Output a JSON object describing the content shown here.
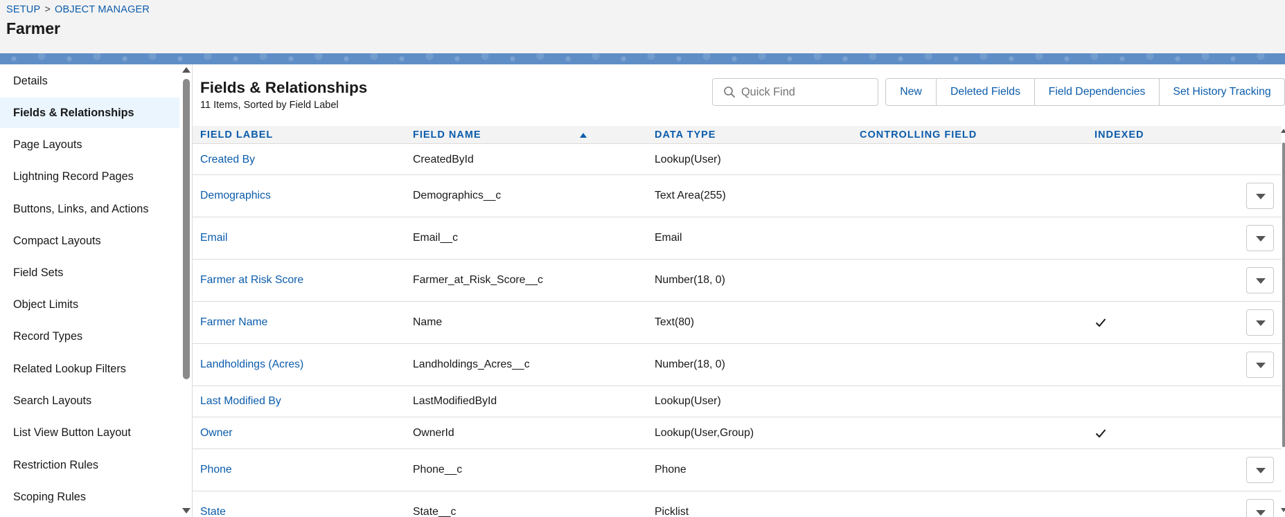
{
  "header": {
    "breadcrumb": [
      "SETUP",
      "OBJECT MANAGER"
    ],
    "breadcrumb_separator": ">",
    "title": "Farmer"
  },
  "sidebar": {
    "items": [
      {
        "label": "Details",
        "active": false
      },
      {
        "label": "Fields & Relationships",
        "active": true
      },
      {
        "label": "Page Layouts",
        "active": false
      },
      {
        "label": "Lightning Record Pages",
        "active": false
      },
      {
        "label": "Buttons, Links, and Actions",
        "active": false
      },
      {
        "label": "Compact Layouts",
        "active": false
      },
      {
        "label": "Field Sets",
        "active": false
      },
      {
        "label": "Object Limits",
        "active": false
      },
      {
        "label": "Record Types",
        "active": false
      },
      {
        "label": "Related Lookup Filters",
        "active": false
      },
      {
        "label": "Search Layouts",
        "active": false
      },
      {
        "label": "List View Button Layout",
        "active": false
      },
      {
        "label": "Restriction Rules",
        "active": false
      },
      {
        "label": "Scoping Rules",
        "active": false
      }
    ]
  },
  "main": {
    "title": "Fields & Relationships",
    "subtitle": "11 Items, Sorted by Field Label",
    "search": {
      "placeholder": "Quick Find",
      "value": ""
    },
    "buttons": [
      "New",
      "Deleted Fields",
      "Field Dependencies",
      "Set History Tracking"
    ],
    "columns": [
      "FIELD LABEL",
      "FIELD NAME",
      "DATA TYPE",
      "CONTROLLING FIELD",
      "INDEXED"
    ],
    "sort": {
      "column": "FIELD LABEL",
      "direction": "ascending"
    },
    "rows": [
      {
        "label": "Created By",
        "name": "CreatedById",
        "type": "Lookup(User)",
        "controlling": "",
        "indexed": false,
        "menu": false
      },
      {
        "label": "Demographics",
        "name": "Demographics__c",
        "type": "Text Area(255)",
        "controlling": "",
        "indexed": false,
        "menu": true
      },
      {
        "label": "Email",
        "name": "Email__c",
        "type": "Email",
        "controlling": "",
        "indexed": false,
        "menu": true
      },
      {
        "label": "Farmer at Risk Score",
        "name": "Farmer_at_Risk_Score__c",
        "type": "Number(18, 0)",
        "controlling": "",
        "indexed": false,
        "menu": true
      },
      {
        "label": "Farmer Name",
        "name": "Name",
        "type": "Text(80)",
        "controlling": "",
        "indexed": true,
        "menu": true
      },
      {
        "label": "Landholdings (Acres)",
        "name": "Landholdings_Acres__c",
        "type": "Number(18, 0)",
        "controlling": "",
        "indexed": false,
        "menu": true
      },
      {
        "label": "Last Modified By",
        "name": "LastModifiedById",
        "type": "Lookup(User)",
        "controlling": "",
        "indexed": false,
        "menu": false
      },
      {
        "label": "Owner",
        "name": "OwnerId",
        "type": "Lookup(User,Group)",
        "controlling": "",
        "indexed": true,
        "menu": false
      },
      {
        "label": "Phone",
        "name": "Phone__c",
        "type": "Phone",
        "controlling": "",
        "indexed": false,
        "menu": true
      },
      {
        "label": "State",
        "name": "State__c",
        "type": "Picklist",
        "controlling": "",
        "indexed": false,
        "menu": true
      }
    ]
  },
  "colors": {
    "link": "#0b5cab",
    "header_bg": "#f3f3f3",
    "banner": "#5f8ec7",
    "active_nav_bg": "#eaf5fe",
    "border": "#dddbda"
  },
  "icons": {
    "search": "search-icon",
    "sort": "sort-ascending-icon",
    "check": "checkmark-icon",
    "row_menu": "chevron-down-icon"
  }
}
